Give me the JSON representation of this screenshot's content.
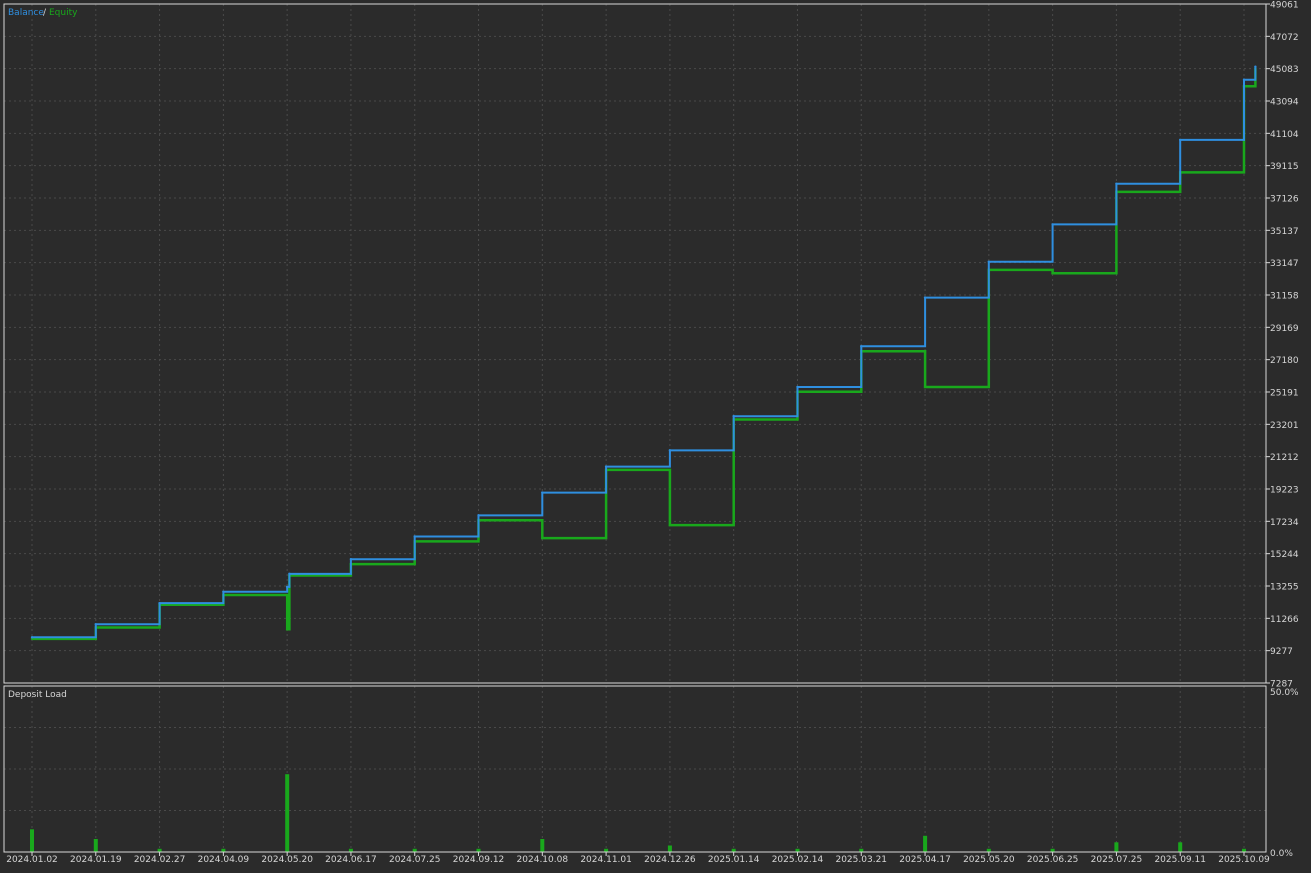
{
  "legend": {
    "balance_label": "Balance",
    "separator": "/",
    "equity_label": "Equity"
  },
  "subpanel": {
    "title": "Deposit Load",
    "max_label": "50.0%",
    "min_label": "0.0%"
  },
  "colors": {
    "background": "#2b2b2b",
    "frame": "#d8d8d8",
    "grid": "#4a4a4a",
    "balance": "#2f8fe0",
    "equity": "#19a81c",
    "text": "#d6d6d6"
  },
  "chart_data": [
    {
      "type": "line",
      "title": "",
      "legend_position": "top-left",
      "grid": true,
      "y_ticks": [
        49061,
        47072,
        45083,
        43094,
        41104,
        39115,
        37126,
        35137,
        33147,
        31158,
        29169,
        27180,
        25191,
        23201,
        21212,
        19223,
        17234,
        15244,
        13255,
        11266,
        9277,
        7287
      ],
      "ylim": [
        7287,
        49061
      ],
      "x_ticks": [
        "2024.01.02",
        "2024.01.19",
        "2024.02.27",
        "2024.04.09",
        "2024.05.20",
        "2024.06.17",
        "2024.07.25",
        "2024.09.12",
        "2024.10.08",
        "2024.11.01",
        "2024.12.26",
        "2025.01.14",
        "2025.02.14",
        "2025.03.21",
        "2025.04.17",
        "2025.05.20",
        "2025.06.25",
        "2025.07.25",
        "2025.09.11",
        "2025.10.09"
      ],
      "series": [
        {
          "name": "Balance",
          "x": [
            "2024.01.02",
            "2024.01.19",
            "2024.02.27",
            "2024.04.09",
            "2024.05.20",
            "2024.05.21",
            "2024.06.17",
            "2024.07.25",
            "2024.09.12",
            "2024.10.08",
            "2024.11.01",
            "2024.12.26",
            "2025.01.14",
            "2025.02.14",
            "2025.03.21",
            "2025.04.17",
            "2025.05.20",
            "2025.06.25",
            "2025.07.25",
            "2025.09.11",
            "2025.10.09",
            "2025.10.14"
          ],
          "values": [
            10100,
            10900,
            12200,
            12900,
            13200,
            14000,
            14900,
            16300,
            17600,
            19000,
            20600,
            21600,
            23700,
            25500,
            28000,
            31000,
            33200,
            35500,
            38000,
            40700,
            44400,
            45200
          ]
        },
        {
          "name": "Equity",
          "x": [
            "2024.01.02",
            "2024.01.19",
            "2024.02.27",
            "2024.04.09",
            "2024.05.20",
            "2024.05.21",
            "2024.06.17",
            "2024.07.25",
            "2024.09.12",
            "2024.10.08",
            "2024.11.01",
            "2024.12.26",
            "2025.01.14",
            "2025.02.14",
            "2025.03.21",
            "2025.04.17",
            "2025.05.20",
            "2025.06.25",
            "2025.07.25",
            "2025.09.11",
            "2025.10.09",
            "2025.10.14"
          ],
          "values": [
            10000,
            10700,
            12100,
            12700,
            10600,
            13900,
            14600,
            16000,
            17300,
            16200,
            20400,
            17000,
            23500,
            25200,
            27700,
            25500,
            32700,
            32500,
            37500,
            38700,
            44000,
            45100
          ]
        }
      ]
    },
    {
      "type": "bar",
      "title": "Deposit Load",
      "ylim": [
        0,
        50
      ],
      "y_ticks": [
        "50.0%",
        "0.0%"
      ],
      "series": [
        {
          "name": "Deposit Load",
          "x": [
            "2024.01.02",
            "2024.01.19",
            "2024.02.27",
            "2024.04.09",
            "2024.05.20",
            "2024.06.17",
            "2024.07.25",
            "2024.09.12",
            "2024.10.08",
            "2024.11.01",
            "2024.12.26",
            "2025.01.14",
            "2025.02.14",
            "2025.03.21",
            "2025.04.17",
            "2025.05.20",
            "2025.06.25",
            "2025.07.25",
            "2025.09.11",
            "2025.10.09"
          ],
          "values": [
            7,
            4,
            1,
            1,
            24,
            1,
            1,
            1,
            4,
            1,
            2,
            1,
            1,
            1,
            5,
            1,
            1,
            3,
            3,
            1
          ]
        }
      ]
    }
  ]
}
